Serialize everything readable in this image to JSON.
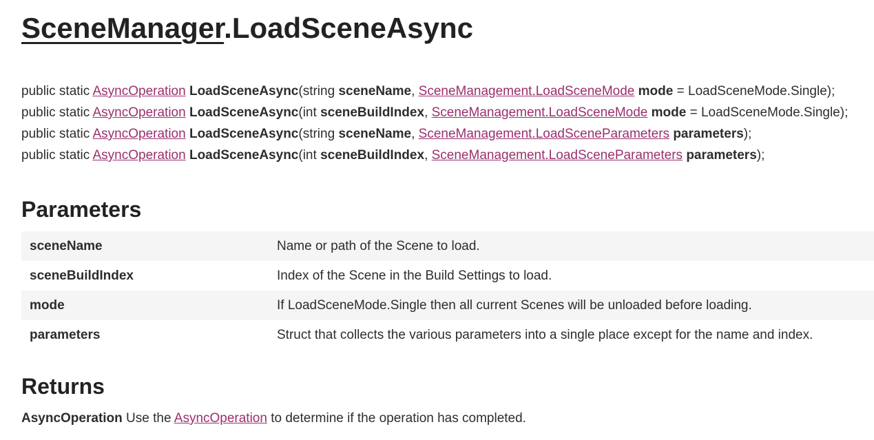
{
  "title": {
    "class_name": "SceneManager",
    "method": ".LoadSceneAsync"
  },
  "signatures": [
    {
      "prefix": "public static ",
      "return_type": "AsyncOperation",
      "method": "LoadSceneAsync",
      "open": "(string ",
      "p1": "sceneName",
      "sep": ", ",
      "type2": "SceneManagement.LoadSceneMode",
      "space": " ",
      "p2": "mode",
      "tail": " = LoadSceneMode.Single);"
    },
    {
      "prefix": "public static ",
      "return_type": "AsyncOperation",
      "method": "LoadSceneAsync",
      "open": "(int ",
      "p1": "sceneBuildIndex",
      "sep": ", ",
      "type2": "SceneManagement.LoadSceneMode",
      "space": " ",
      "p2": "mode",
      "tail": " = LoadSceneMode.Single);"
    },
    {
      "prefix": "public static ",
      "return_type": "AsyncOperation",
      "method": "LoadSceneAsync",
      "open": "(string ",
      "p1": "sceneName",
      "sep": ", ",
      "type2": "SceneManagement.LoadSceneParameters",
      "space": " ",
      "p2": "parameters",
      "tail": ");"
    },
    {
      "prefix": "public static ",
      "return_type": "AsyncOperation",
      "method": "LoadSceneAsync",
      "open": "(int ",
      "p1": "sceneBuildIndex",
      "sep": ", ",
      "type2": "SceneManagement.LoadSceneParameters",
      "space": " ",
      "p2": "parameters",
      "tail": ");"
    }
  ],
  "parameters": {
    "heading": "Parameters",
    "rows": [
      {
        "name": "sceneName",
        "description": "Name or path of the Scene to load."
      },
      {
        "name": "sceneBuildIndex",
        "description": "Index of the Scene in the Build Settings to load."
      },
      {
        "name": "mode",
        "description": "If LoadSceneMode.Single then all current Scenes will be unloaded before loading."
      },
      {
        "name": "parameters",
        "description": "Struct that collects the various parameters into a single place except for the name and index."
      }
    ]
  },
  "returns": {
    "heading": "Returns",
    "type": "AsyncOperation",
    "text_before": " Use the ",
    "link": "AsyncOperation",
    "text_after": " to determine if the operation has completed."
  },
  "colors": {
    "link": "#9b2f6e",
    "text": "#2d2d2d",
    "heading": "#222222",
    "row_alt": "#f5f5f5"
  }
}
